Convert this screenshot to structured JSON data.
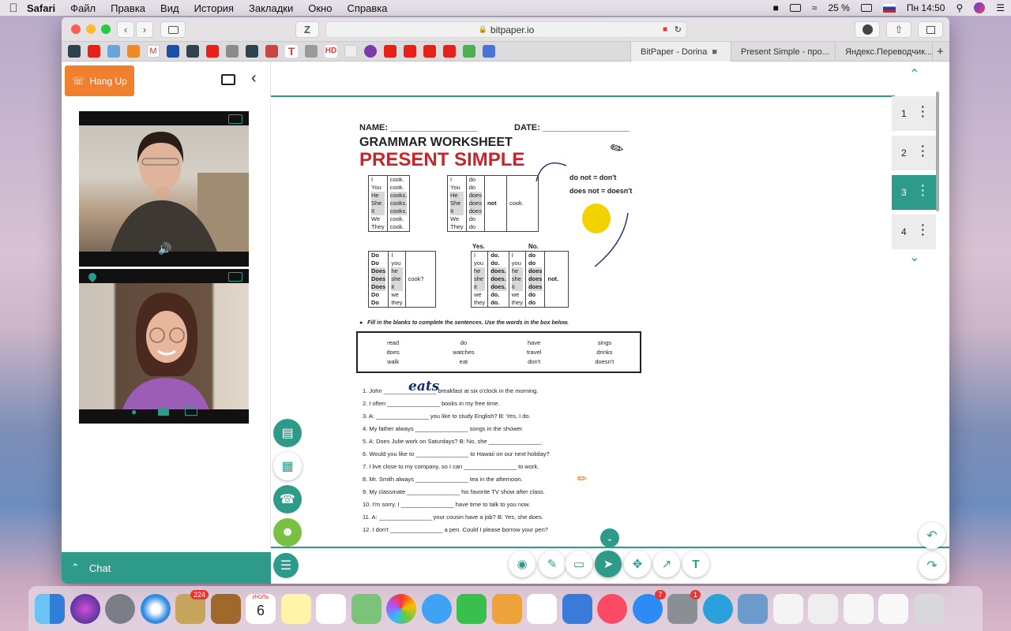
{
  "menubar": {
    "app": "Safari",
    "items": [
      "Файл",
      "Правка",
      "Вид",
      "История",
      "Закладки",
      "Окно",
      "Справка"
    ],
    "battery": "25 %",
    "clock": "Пн 14:50"
  },
  "browser": {
    "url": "bitpaper.io",
    "tabs": [
      "BitPaper - Dorina",
      "Present Simple - про...",
      "Яндекс.Переводчик..."
    ],
    "z_button": "Z"
  },
  "call": {
    "hangup_label": "Hang Up",
    "chat_label": "Chat"
  },
  "pages": [
    "1",
    "2",
    "3",
    "4"
  ],
  "active_page": "3",
  "worksheet": {
    "name_label": "NAME: __________________",
    "date_label": "DATE: __________________",
    "title1": "GRAMMAR WORKSHEET",
    "title2": "PRESENT SIMPLE",
    "note1": "do not = don't",
    "note2": "does not = doesn't",
    "yes": "Yes.",
    "no": "No.",
    "instruction": "Fill in the blanks to complete the sentences.  Use the words in the box below.",
    "word_box": [
      [
        "read",
        "do",
        "have",
        "sings"
      ],
      [
        "does",
        "watches",
        "travel",
        "drinks"
      ],
      [
        "walk",
        "eat",
        "don't",
        "doesn't"
      ]
    ],
    "handwritten": "eats",
    "sentences": [
      "1.  John ________________ breakfast at six o'clock in the morning.",
      "2.  I often ________________ books in my free time.",
      "3.  A: ________________ you like to study English?   B: Yes, I do.",
      "4.  My father always ________________ songs in the shower.",
      "5.  A: Does Julie work on Saturdays?  B: No, she ________________.",
      "6.  Would you like to ________________ to Hawaii on our next holiday?",
      "7.  I live close to my company, so I can ________________ to work.",
      "8.  Mr. Smith always ________________ tea in the afternoon.",
      "9.  My classmate ________________ his favorite TV show after class.",
      "10. I'm sorry.  I ________________ have time to talk to you now.",
      "11. A: ________________ your cousin have a job?  B: Yes, she does.",
      "12. I don't ________________ a pen.  Could I please borrow your pen?"
    ],
    "table1_pron": [
      "I",
      "You",
      "He",
      "She",
      "It",
      "We",
      "They"
    ],
    "table1_verb": [
      "cook.",
      "cook.",
      "cooks.",
      "cooks.",
      "cooks.",
      "cook.",
      "cook."
    ],
    "table2_pron": [
      "I",
      "You",
      "He",
      "She",
      "It",
      "We",
      "They"
    ],
    "table2_aux": [
      "do",
      "do",
      "does",
      "does",
      "does",
      "do",
      "do"
    ],
    "table2_not": "not",
    "table2_verb": "cook.",
    "q_aux": [
      "Do",
      "Do",
      "Does",
      "Does",
      "Does",
      "Do",
      "Do"
    ],
    "q_pron": [
      "I",
      "you",
      "he",
      "she",
      "it",
      "we",
      "they"
    ],
    "q_verb": "cook?",
    "yes_pron": [
      "I",
      "you",
      "he",
      "she",
      "it",
      "we",
      "they"
    ],
    "yes_aux": [
      "do.",
      "do.",
      "does.",
      "does.",
      "does.",
      "do.",
      "do."
    ],
    "no_pron": [
      "I",
      "you",
      "he",
      "she",
      "it",
      "we",
      "they"
    ],
    "no_aux": [
      "do",
      "do",
      "does",
      "does",
      "does",
      "do",
      "do"
    ],
    "no_not": "not."
  },
  "dock": {
    "mail_badge": "224",
    "calendar_month": "ИЮЛЬ",
    "calendar_day": "6",
    "appstore_badge": "7",
    "prefs_badge": "1"
  },
  "colors": {
    "accent": "#2e9a8a",
    "hangup": "#f07f2e",
    "title_red": "#c8242a"
  }
}
